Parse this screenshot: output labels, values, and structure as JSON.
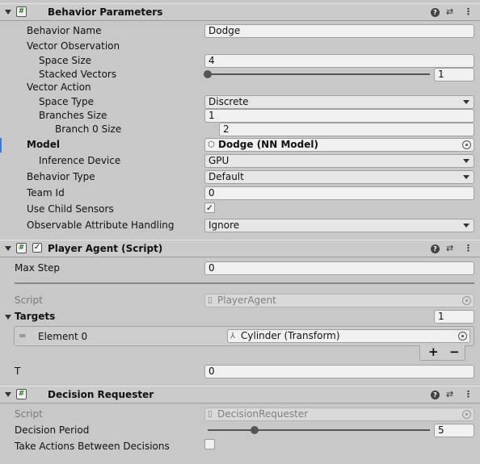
{
  "behavior_parameters": {
    "title": "Behavior Parameters",
    "rows": {
      "behavior_name": {
        "label": "Behavior Name",
        "value": "Dodge"
      },
      "vector_observation": {
        "label": "Vector Observation"
      },
      "space_size": {
        "label": "Space Size",
        "value": "4"
      },
      "stacked_vectors": {
        "label": "Stacked Vectors",
        "value": "1"
      },
      "vector_action": {
        "label": "Vector Action"
      },
      "space_type": {
        "label": "Space Type",
        "value": "Discrete"
      },
      "branches_size": {
        "label": "Branches Size",
        "value": "1"
      },
      "branch0_size": {
        "label": "Branch 0 Size",
        "value": "2"
      },
      "model": {
        "label": "Model",
        "value": "Dodge (NN Model)"
      },
      "inference_device": {
        "label": "Inference Device",
        "value": "GPU"
      },
      "behavior_type": {
        "label": "Behavior Type",
        "value": "Default"
      },
      "team_id": {
        "label": "Team Id",
        "value": "0"
      },
      "use_child_sensors": {
        "label": "Use Child Sensors",
        "checked": true
      },
      "observable_attribute": {
        "label": "Observable Attribute Handling",
        "value": "Ignore"
      }
    }
  },
  "player_agent": {
    "title": "Player Agent (Script)",
    "enabled": true,
    "max_step": {
      "label": "Max Step",
      "value": "0"
    },
    "script": {
      "label": "Script",
      "value": "PlayerAgent"
    },
    "targets": {
      "label": "Targets",
      "count": "1",
      "element0": {
        "label": "Element 0",
        "value": "Cylinder (Transform)"
      },
      "add": "+",
      "remove": "−"
    },
    "t": {
      "label": "T",
      "value": "0"
    }
  },
  "decision_requester": {
    "title": "Decision Requester",
    "script": {
      "label": "Script",
      "value": "DecisionRequester"
    },
    "decision_period": {
      "label": "Decision Period",
      "value": "5"
    },
    "take_actions": {
      "label": "Take Actions Between Decisions",
      "checked": false
    }
  },
  "header_icons": {
    "help": "?",
    "settings": "⇄",
    "more": "⋮"
  },
  "slider_levels": {
    "stacked_vectors": 0.0,
    "decision_period": 0.21
  },
  "colors": {
    "accent": "#3a79d8",
    "background": "#c8c8c8"
  }
}
